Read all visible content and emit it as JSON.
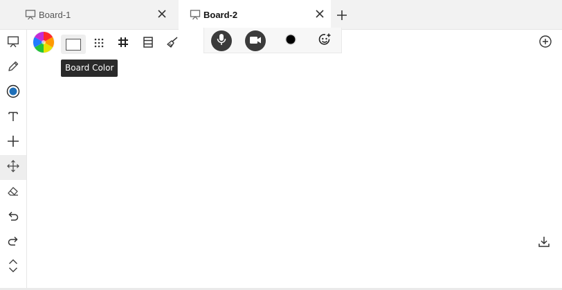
{
  "tabs": [
    {
      "label": "Board-1",
      "icon": "presentation-board-icon",
      "active": false
    },
    {
      "label": "Board-2",
      "icon": "presentation-board-icon",
      "active": true
    }
  ],
  "add_tab_icon": "plus-icon",
  "sidebar": {
    "tools": [
      {
        "name": "board-tool",
        "icon": "presentation-board-icon"
      },
      {
        "name": "pencil-tool",
        "icon": "pencil-icon"
      },
      {
        "name": "color-picker-tool",
        "icon": "radio-dot-icon",
        "accent": "#1e6fb8"
      },
      {
        "name": "text-tool",
        "icon": "text-t-icon"
      },
      {
        "name": "shape-tool",
        "icon": "plus-icon"
      },
      {
        "name": "move-tool",
        "icon": "move-arrows-icon",
        "selected": true
      },
      {
        "name": "eraser-tool",
        "icon": "eraser-icon"
      },
      {
        "name": "undo-tool",
        "icon": "undo-icon"
      },
      {
        "name": "redo-tool",
        "icon": "redo-icon"
      },
      {
        "name": "expand-tool",
        "icon": "chevron-up-down-icon"
      }
    ]
  },
  "toolbar": {
    "items": [
      "color-wheel-icon",
      "board-color-swatch",
      "dot-grid-icon",
      "hash-grid-icon",
      "lined-page-icon",
      "broom-icon"
    ],
    "tooltip": "Board Color"
  },
  "media": {
    "items": [
      "microphone-icon",
      "video-camera-icon",
      "record-dot-icon",
      "add-emoji-icon"
    ]
  },
  "right_controls": [
    "zoom-in-icon",
    "download-icon"
  ]
}
